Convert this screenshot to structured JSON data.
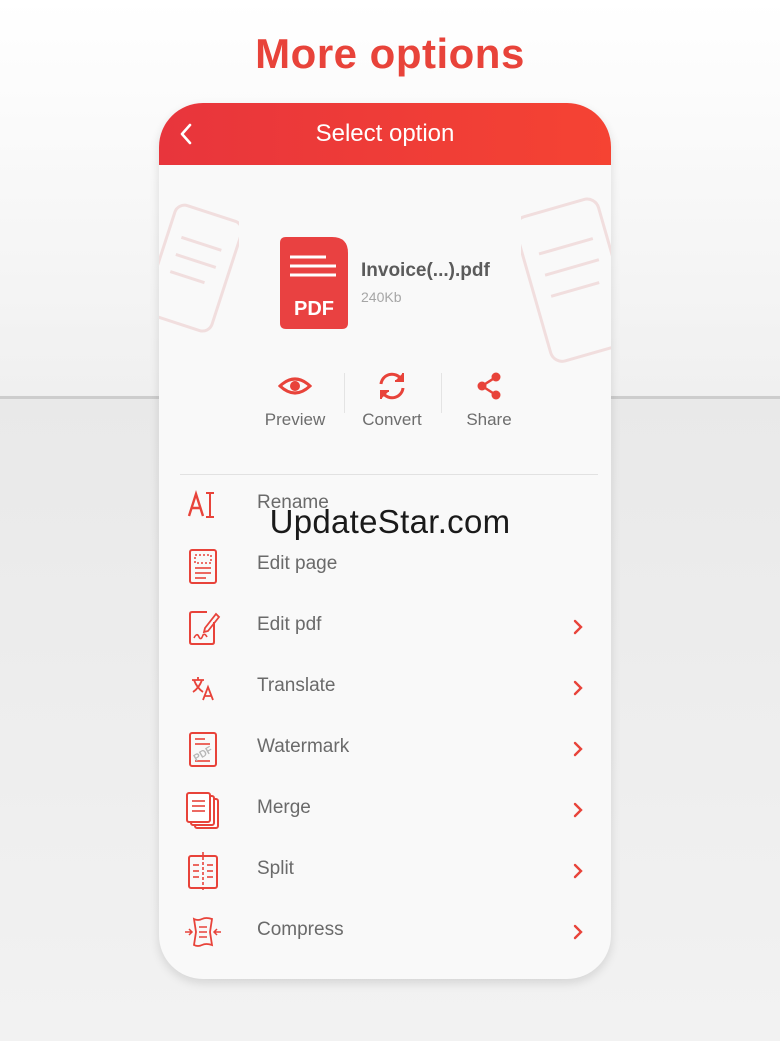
{
  "headline": "More options",
  "appbar": {
    "title": "Select option"
  },
  "file": {
    "name": "Invoice(...).pdf",
    "size": "240Kb",
    "badge": "PDF"
  },
  "actions": [
    {
      "label": "Preview",
      "icon": "eye-icon"
    },
    {
      "label": "Convert",
      "icon": "refresh-icon"
    },
    {
      "label": "Share",
      "icon": "share-icon"
    }
  ],
  "menu": [
    {
      "label": "Rename",
      "icon": "rename-text-icon",
      "has_chevron": false
    },
    {
      "label": "Edit page",
      "icon": "edit-page-icon",
      "has_chevron": false
    },
    {
      "label": "Edit pdf",
      "icon": "edit-pdf-signature-icon",
      "has_chevron": true
    },
    {
      "label": "Translate",
      "icon": "translate-icon",
      "has_chevron": true
    },
    {
      "label": "Watermark",
      "icon": "watermark-icon",
      "has_chevron": true
    },
    {
      "label": "Merge",
      "icon": "merge-icon",
      "has_chevron": true
    },
    {
      "label": "Split",
      "icon": "split-icon",
      "has_chevron": true
    },
    {
      "label": "Compress",
      "icon": "compress-icon",
      "has_chevron": true
    }
  ],
  "watermark_text": "UpdateStar.com",
  "colors": {
    "accent": "#e8433a",
    "appbar_start": "#e8353c",
    "appbar_end": "#f54333",
    "label": "#6a6a6a"
  }
}
